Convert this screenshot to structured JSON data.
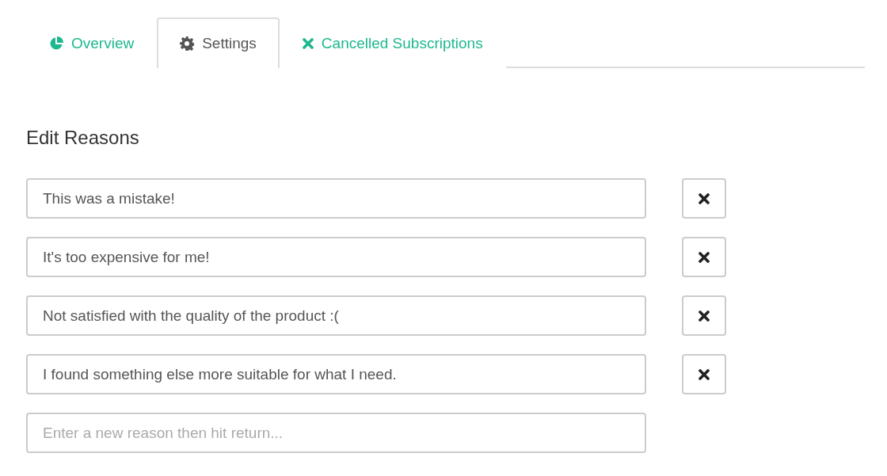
{
  "tabs": [
    {
      "label": "Overview",
      "selected": false,
      "kind": "pie"
    },
    {
      "label": "Settings",
      "selected": true,
      "kind": "gear"
    },
    {
      "label": "Cancelled Subscriptions",
      "selected": false,
      "kind": "cross"
    }
  ],
  "heading": "Edit Reasons",
  "reasons": [
    {
      "value": "This was a mistake!"
    },
    {
      "value": "It's too expensive for me!"
    },
    {
      "value": "Not satisfied with the quality of the product :("
    },
    {
      "value": "I found something else more suitable for what I need."
    }
  ],
  "new_reason": {
    "placeholder": "Enter a new reason then hit return..."
  }
}
